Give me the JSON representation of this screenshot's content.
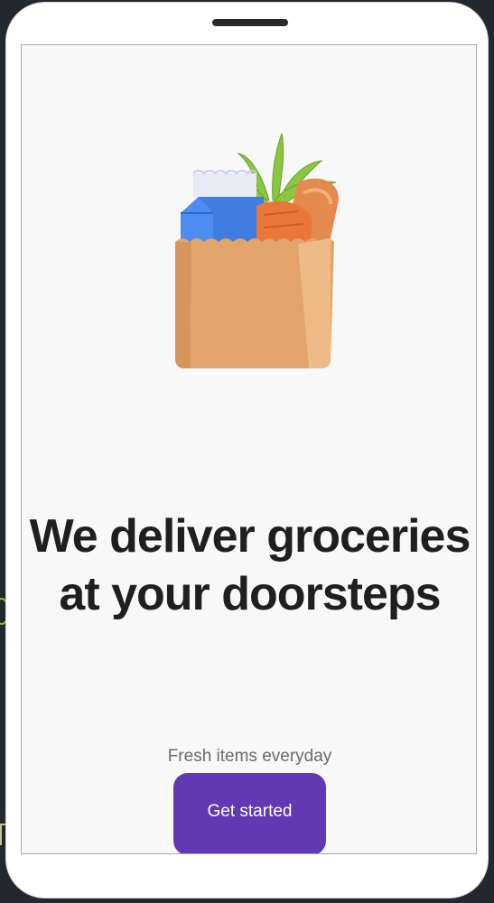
{
  "onboarding": {
    "headline": "We deliver groceries at your doorsteps",
    "subtitle": "Fresh items everyday",
    "cta_label": "Get started",
    "illustration": "grocery-bag-icon"
  },
  "colors": {
    "accent": "#6238b3",
    "screen_background": "#f9f8f8",
    "headline": "#1f1f1f",
    "subtitle": "#6b6b6b"
  }
}
